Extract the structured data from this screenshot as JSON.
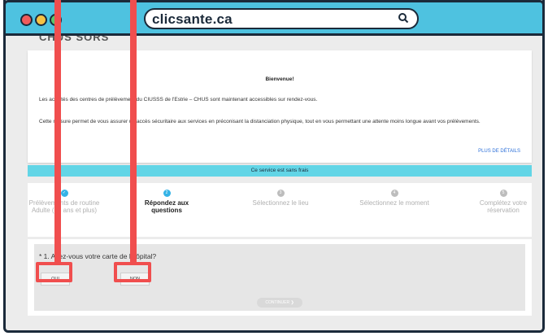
{
  "browser": {
    "url": "clicsante.ca"
  },
  "page": {
    "cropped_heading": "CHUS SORS",
    "welcome": {
      "title": "Bienvenue!",
      "paragraph1": "Les activités des centres de prélèvement du CIUSSS de l'Estrie – CHUS sont maintenant accessibles sur rendez-vous.",
      "paragraph2": "Cette mesure permet de vous assurer un accès sécuritaire aux services en préconisant la distanciation physique, tout en vous permettant une attente moins longue avant vos prélèvements.",
      "details_link": "PLUS DE DÉTAILS"
    },
    "banner": "Ce service est sans frais",
    "steps": [
      {
        "number": "1",
        "label": "Prélèvements de routine Adulte (18 ans et plus)",
        "state": "done"
      },
      {
        "number": "2",
        "label": "Répondez aux questions",
        "state": "active"
      },
      {
        "number": "3",
        "label": "Sélectionnez le lieu",
        "state": "pending"
      },
      {
        "number": "4",
        "label": "Sélectionnez le moment",
        "state": "pending"
      },
      {
        "number": "5",
        "label": "Complétez votre réservation",
        "state": "pending"
      }
    ],
    "question": {
      "text": "* 1. Avez-vous votre carte de l'hôpital?",
      "yes_label": "OUI",
      "no_label": "NON",
      "continue_label": "CONTINUER ❯"
    }
  },
  "colors": {
    "accent": "#34b3e6",
    "banner": "#62d5e6",
    "highlight": "#f04e4e",
    "titlebar": "#4ec2e0"
  }
}
